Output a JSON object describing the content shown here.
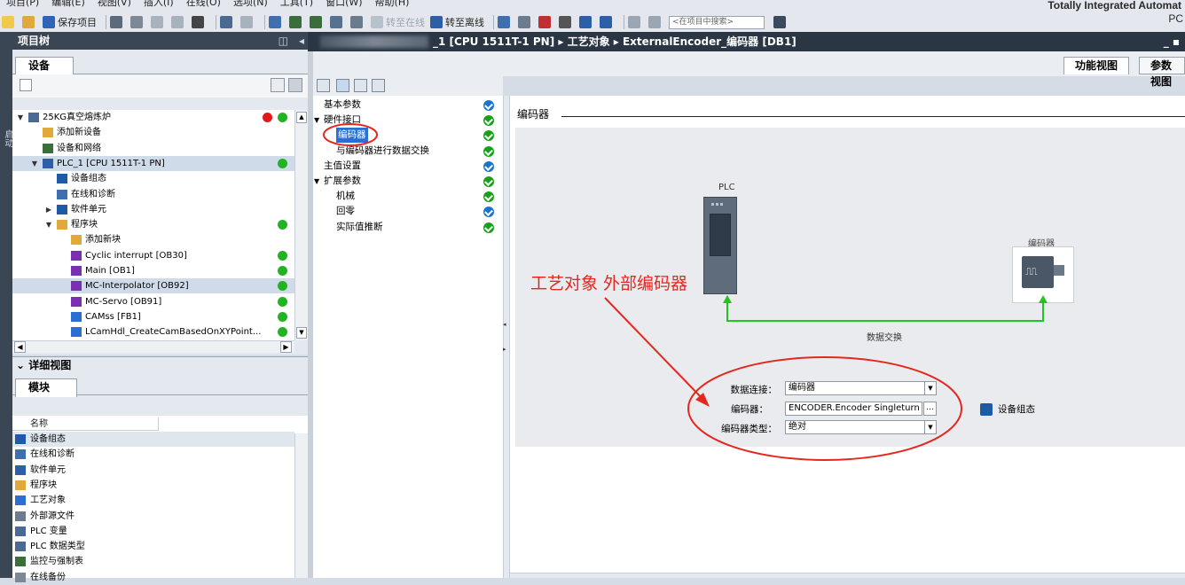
{
  "menubar": {
    "items": [
      "项目(P)",
      "编辑(E)",
      "视图(V)",
      "插入(I)",
      "在线(O)",
      "选项(N)",
      "工具(T)",
      "窗口(W)",
      "帮助(H)"
    ],
    "brand": "Totally Integrated Automat",
    "brand_sub": "PC"
  },
  "toolbar": {
    "save_label": "保存项目",
    "go_online": "转至在线",
    "go_offline": "转至离线",
    "search_placeholder": "<在项目中搜索>"
  },
  "sidestrip": {
    "label": "启动"
  },
  "project_tree": {
    "title": "项目树",
    "tab": "设备",
    "rows": [
      {
        "label": "25KG真空熔炼炉",
        "depth": 0,
        "expanded": "▼",
        "status": "red-green"
      },
      {
        "label": "添加新设备",
        "depth": 1
      },
      {
        "label": "设备和网络",
        "depth": 1
      },
      {
        "label": "PLC_1 [CPU 1511T-1 PN]",
        "depth": 1,
        "expanded": "▼",
        "status": "green",
        "selected": true
      },
      {
        "label": "设备组态",
        "depth": 2
      },
      {
        "label": "在线和诊断",
        "depth": 2
      },
      {
        "label": "软件单元",
        "depth": 2,
        "expanded": "▶"
      },
      {
        "label": "程序块",
        "depth": 2,
        "expanded": "▼",
        "status": "green"
      },
      {
        "label": "添加新块",
        "depth": 3
      },
      {
        "label": "Cyclic interrupt [OB30]",
        "depth": 3,
        "status": "green"
      },
      {
        "label": "Main [OB1]",
        "depth": 3,
        "status": "green"
      },
      {
        "label": "MC-Interpolator [OB92]",
        "depth": 3,
        "status": "green",
        "selected": true
      },
      {
        "label": "MC-Servo [OB91]",
        "depth": 3,
        "status": "green"
      },
      {
        "label": "CAMss [FB1]",
        "depth": 3,
        "status": "green"
      },
      {
        "label": "LCamHdl_CreateCamBasedOnXYPoint...",
        "depth": 3,
        "status": "green"
      }
    ]
  },
  "detail_view": {
    "title": "详细视图",
    "tab": "模块",
    "column": "名称",
    "rows": [
      "设备组态",
      "在线和诊断",
      "软件单元",
      "程序块",
      "工艺对象",
      "外部源文件",
      "PLC 变量",
      "PLC 数据类型",
      "监控与强制表",
      "在线备份"
    ]
  },
  "editor": {
    "breadcrumb": "_1 [CPU 1511T-1 PN]  ▸  工艺对象  ▸  ExternalEncoder_编码器 [DB1]",
    "window_ctrl": "_ ▪",
    "tabs": [
      "功能视图",
      "参数视图"
    ],
    "nav": [
      {
        "label": "基本参数",
        "indent": 0,
        "check": "blue"
      },
      {
        "label": "硬件接口",
        "indent": 0,
        "expanded": "▼",
        "check": "green"
      },
      {
        "label": "编码器",
        "indent": 2,
        "check": "green",
        "selected": true
      },
      {
        "label": "与编码器进行数据交换",
        "indent": 2,
        "check": "green"
      },
      {
        "label": "主值设置",
        "indent": 0,
        "check": "blue"
      },
      {
        "label": "扩展参数",
        "indent": 0,
        "expanded": "▼",
        "check": "green"
      },
      {
        "label": "机械",
        "indent": 2,
        "check": "green"
      },
      {
        "label": "回零",
        "indent": 2,
        "check": "blue"
      },
      {
        "label": "实际值推断",
        "indent": 2,
        "check": "green"
      }
    ],
    "section_title": "编码器",
    "diagram": {
      "plc_label": "PLC",
      "encoder_label": "编码器",
      "exchange_label": "数据交换"
    },
    "annotation": "工艺对象 外部编码器",
    "form": {
      "data_conn_label": "数据连接：",
      "data_conn_value": "编码器",
      "encoder_label": "编码器：",
      "encoder_value": "ENCODER.Encoder Singleturn",
      "encoder_type_label": "编码器类型：",
      "encoder_type_value": "绝对",
      "device_config_link": "设备组态"
    }
  },
  "colors": {
    "annotation_red": "#e5271e",
    "link_green": "#22c322",
    "status_green": "#22b322",
    "status_blue": "#1a73d1"
  }
}
